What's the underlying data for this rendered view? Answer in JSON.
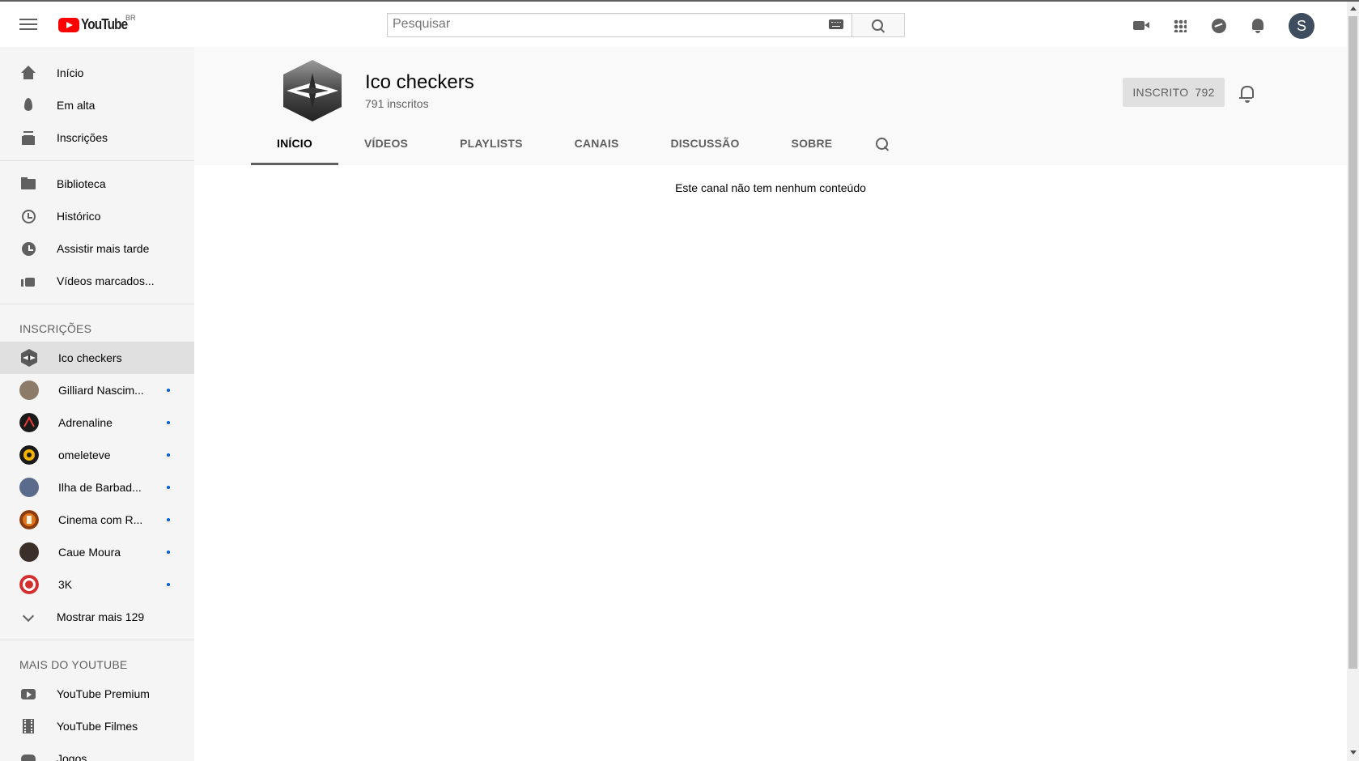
{
  "masthead": {
    "logo_text": "YouTube",
    "country_code": "BR",
    "search_placeholder": "Pesquisar",
    "avatar_letter": "S",
    "icons": [
      "menu-icon",
      "keyboard-icon",
      "search-icon",
      "video-camera-icon",
      "apps-grid-icon",
      "messages-icon",
      "notifications-bell-icon"
    ]
  },
  "sidebar": {
    "primary": [
      {
        "label": "Início",
        "icon": "home-icon"
      },
      {
        "label": "Em alta",
        "icon": "trending-fire-icon"
      },
      {
        "label": "Inscrições",
        "icon": "subscriptions-icon"
      }
    ],
    "library": [
      {
        "label": "Biblioteca",
        "icon": "library-folder-icon"
      },
      {
        "label": "Histórico",
        "icon": "history-icon"
      },
      {
        "label": "Assistir mais tarde",
        "icon": "watch-later-clock-icon"
      },
      {
        "label": "Vídeos marcados...",
        "icon": "liked-thumb-icon"
      }
    ],
    "subscriptions_title": "INSCRIÇÕES",
    "subscriptions": [
      {
        "label": "Ico checkers",
        "active": true,
        "new": false,
        "color": "#4a4a4a"
      },
      {
        "label": "Gilliard Nascim...",
        "active": false,
        "new": true,
        "color": "#8d7b6a"
      },
      {
        "label": "Adrenaline",
        "active": false,
        "new": true,
        "color": "#1a1a1a"
      },
      {
        "label": "omeleteve",
        "active": false,
        "new": true,
        "color": "#f4b400"
      },
      {
        "label": "Ilha de Barbad...",
        "active": false,
        "new": true,
        "color": "#5a6b8c"
      },
      {
        "label": "Cinema com R...",
        "active": false,
        "new": true,
        "color": "#e0761a"
      },
      {
        "label": "Caue Moura",
        "active": false,
        "new": true,
        "color": "#3b2f2a"
      },
      {
        "label": "3K",
        "active": false,
        "new": true,
        "color": "#d32f2f"
      }
    ],
    "show_more": "Mostrar mais 129",
    "more_title": "MAIS DO YOUTUBE",
    "more": [
      {
        "label": "YouTube Premium",
        "icon": "youtube-premium-icon"
      },
      {
        "label": "YouTube Filmes",
        "icon": "film-icon"
      },
      {
        "label": "Jogos",
        "icon": "gaming-icon"
      }
    ]
  },
  "channel": {
    "name": "Ico checkers",
    "subscribers": "791 inscritos",
    "subscribed_label": "INSCRITO",
    "subscribed_count": "792",
    "tabs": [
      "INÍCIO",
      "VÍDEOS",
      "PLAYLISTS",
      "CANAIS",
      "DISCUSSÃO",
      "SOBRE"
    ],
    "active_tab": "INÍCIO",
    "empty_message": "Este canal não tem nenhum conteúdo"
  },
  "colors": {
    "brand_red": "#ff0000",
    "new_dot": "#065fd4",
    "active_bg": "#e0e0e0"
  }
}
